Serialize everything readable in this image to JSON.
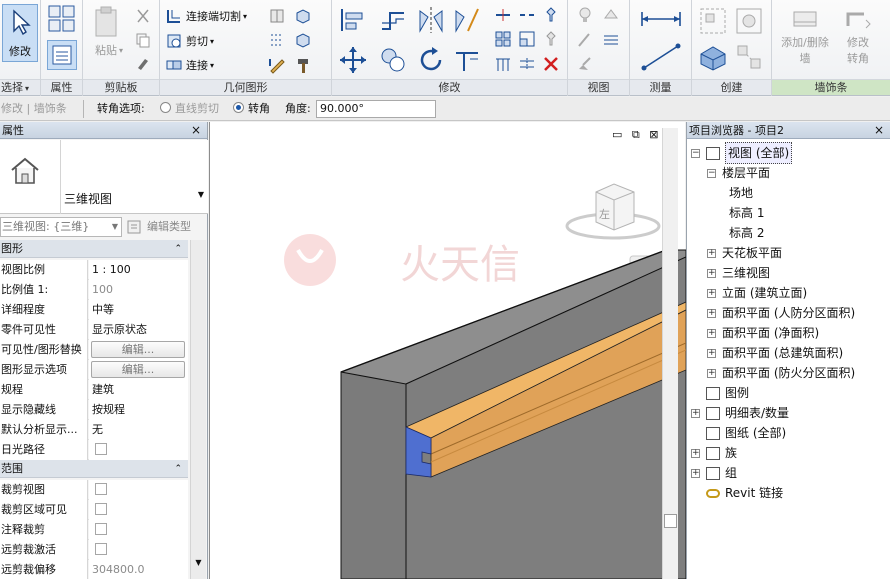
{
  "ribbon": {
    "select": {
      "modify_label": "修改",
      "footer": "选择",
      "footer_caret": "▾"
    },
    "properties_panel": {
      "footer": "属性"
    },
    "clipboard": {
      "paste_label": "粘贴",
      "footer": "剪贴板"
    },
    "geometry": {
      "wall_joins": "连接端切割",
      "cut": "剪切",
      "join": "连接",
      "footer": "几何图形"
    },
    "modify": {
      "footer": "修改"
    },
    "view": {
      "footer": "视图"
    },
    "measure": {
      "footer": "测量"
    },
    "create": {
      "footer": "创建"
    },
    "wall_sweep": {
      "add_remove_l1": "添加/删除",
      "add_remove_l2": "墙",
      "modify_turn_l1": "修改",
      "modify_turn_l2": "转角",
      "footer": "墙饰条"
    }
  },
  "options_bar": {
    "context": "修改 | 墙饰条",
    "corner_options_label": "转角选项:",
    "straight_cut_label": "直线剪切",
    "turn_label": "转角",
    "angle_label": "角度:",
    "angle_value": "90.000°"
  },
  "properties": {
    "header": "属性",
    "close": "×",
    "type_name": "三维视图",
    "instance_selector": "三维视图: {三维}",
    "edit_type": "编辑类型",
    "sections": [
      {
        "name": "图形",
        "chevron": "⌃"
      },
      {
        "name": "范围",
        "chevron": "⌃"
      }
    ],
    "rows": [
      {
        "key": "视图比例",
        "value": "1 : 100"
      },
      {
        "key": "比例值 1:",
        "value": "100"
      },
      {
        "key": "详细程度",
        "value": "中等"
      },
      {
        "key": "零件可见性",
        "value": "显示原状态"
      },
      {
        "key": "可见性/图形替换",
        "value": "编辑..."
      },
      {
        "key": "图形显示选项",
        "value": "编辑..."
      },
      {
        "key": "规程",
        "value": "建筑"
      },
      {
        "key": "显示隐藏线",
        "value": "按规程"
      },
      {
        "key": "默认分析显示...",
        "value": "无"
      },
      {
        "key": "日光路径",
        "value": ""
      },
      {
        "key": "裁剪视图",
        "value": ""
      },
      {
        "key": "裁剪区域可见",
        "value": ""
      },
      {
        "key": "注释裁剪",
        "value": ""
      },
      {
        "key": "远剪裁激活",
        "value": ""
      },
      {
        "key": "远剪裁偏移",
        "value": "304800.0"
      }
    ]
  },
  "canvas": {
    "window_controls": [
      "▭",
      "⧉",
      "⊠"
    ],
    "watermark": "火天信",
    "viewcube_face": "左",
    "colors": {
      "wall": "#7b7b7b",
      "wall_top": "#8e8e8e",
      "sweep": "#e0a258",
      "sweep_dark": "#b57a36",
      "profile": "#4f6fd0"
    }
  },
  "browser": {
    "header": "项目浏览器 - 项目2",
    "close": "×",
    "nodes": [
      {
        "label": "视图 (全部)",
        "toggle": "−",
        "level": 0
      },
      {
        "label": "楼层平面",
        "toggle": "−",
        "level": 1
      },
      {
        "label": "场地",
        "toggle": "",
        "level": 2
      },
      {
        "label": "标高 1",
        "toggle": "",
        "level": 2
      },
      {
        "label": "标高 2",
        "toggle": "",
        "level": 2
      },
      {
        "label": "天花板平面",
        "toggle": "+",
        "level": 1
      },
      {
        "label": "三维视图",
        "toggle": "+",
        "level": 1
      },
      {
        "label": "立面 (建筑立面)",
        "toggle": "+",
        "level": 1
      },
      {
        "label": "面积平面 (人防分区面积)",
        "toggle": "+",
        "level": 1
      },
      {
        "label": "面积平面 (净面积)",
        "toggle": "+",
        "level": 1
      },
      {
        "label": "面积平面 (总建筑面积)",
        "toggle": "+",
        "level": 1
      },
      {
        "label": "面积平面 (防火分区面积)",
        "toggle": "+",
        "level": 1
      },
      {
        "label": "图例",
        "toggle": "",
        "level": 0
      },
      {
        "label": "明细表/数量",
        "toggle": "+",
        "level": 0
      },
      {
        "label": "图纸 (全部)",
        "toggle": "",
        "level": 0
      },
      {
        "label": "族",
        "toggle": "+",
        "level": 0
      },
      {
        "label": "组",
        "toggle": "+",
        "level": 0
      },
      {
        "label": "Revit 链接",
        "toggle": "",
        "level": 0
      }
    ]
  }
}
